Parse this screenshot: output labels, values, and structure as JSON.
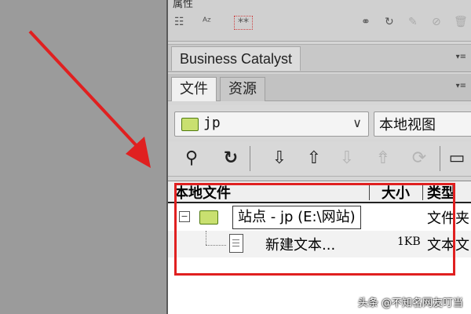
{
  "top_toolbar": {
    "label": "属性"
  },
  "panel_header": {
    "tab_label": "Business Catalyst",
    "menu_icon": "panel-menu-icon"
  },
  "files_panel": {
    "tabs": [
      {
        "label": "文件",
        "active": true
      },
      {
        "label": "资源",
        "active": false
      }
    ],
    "site_select": {
      "value": "jp",
      "icon": "folder-icon"
    },
    "view_select": {
      "value": "本地视图"
    },
    "toolbar_icons": [
      "connect-icon",
      "refresh-icon",
      "get-files-icon",
      "put-files-icon",
      "check-out-icon",
      "check-in-icon",
      "synchronize-icon",
      "expand-icon"
    ],
    "columns": {
      "local_files": "本地文件",
      "size": "大小",
      "type": "类型"
    },
    "rows": [
      {
        "name": "站点 - jp (E:\\网站)",
        "size": "",
        "type": "文件夹"
      },
      {
        "name": "新建文本...",
        "size": "1KB",
        "type": "文本文"
      }
    ]
  },
  "annotation": {
    "color": "#e02020"
  },
  "watermark": "头条 @不知名网友叮当"
}
